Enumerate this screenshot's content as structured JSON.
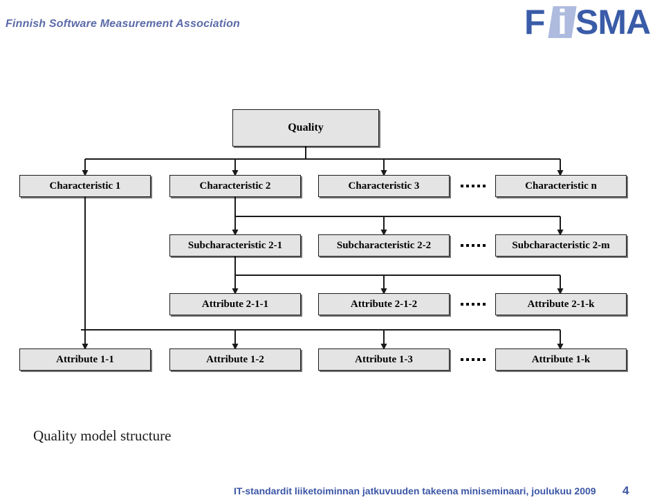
{
  "header": {
    "association_title": "Finnish Software Measurement Association",
    "logo": {
      "f": "F",
      "i": "i",
      "sma": "SMA",
      "brand_color": "#3a5ca8",
      "tile_color": "#aebbdf"
    }
  },
  "diagram": {
    "title": "Quality model structure",
    "root": {
      "label": "Quality"
    },
    "levels": [
      {
        "name": "characteristics",
        "nodes": [
          {
            "label": "Characteristic 1"
          },
          {
            "label": "Characteristic 2"
          },
          {
            "label": "Characteristic 3"
          },
          {
            "label": "Characteristic n"
          }
        ],
        "ellipsis_after": 2
      },
      {
        "name": "subcharacteristics",
        "nodes": [
          {
            "label": "Subcharacteristic 2-1"
          },
          {
            "label": "Subcharacteristic 2-2"
          },
          {
            "label": "Subcharacteristic 2-m"
          }
        ],
        "ellipsis_after": 1
      },
      {
        "name": "attributes-level-2",
        "nodes": [
          {
            "label": "Attribute 2-1-1"
          },
          {
            "label": "Attribute 2-1-2"
          },
          {
            "label": "Attribute 2-1-k"
          }
        ],
        "ellipsis_after": 1
      },
      {
        "name": "attributes-level-1",
        "nodes": [
          {
            "label": "Attribute 1-1"
          },
          {
            "label": "Attribute 1-2"
          },
          {
            "label": "Attribute 1-3"
          },
          {
            "label": "Attribute 1-k"
          }
        ],
        "ellipsis_after": 2
      }
    ],
    "colors": {
      "node_fill": "#e4e4e4",
      "node_border": "#1a1a1a",
      "connector": "#1a1a1a"
    }
  },
  "footer": {
    "text": "IT-standardit liiketoiminnan jatkuvuuden takeena miniseminaari, joulukuu 2009",
    "page_number": "4",
    "color": "#3a55a5"
  }
}
